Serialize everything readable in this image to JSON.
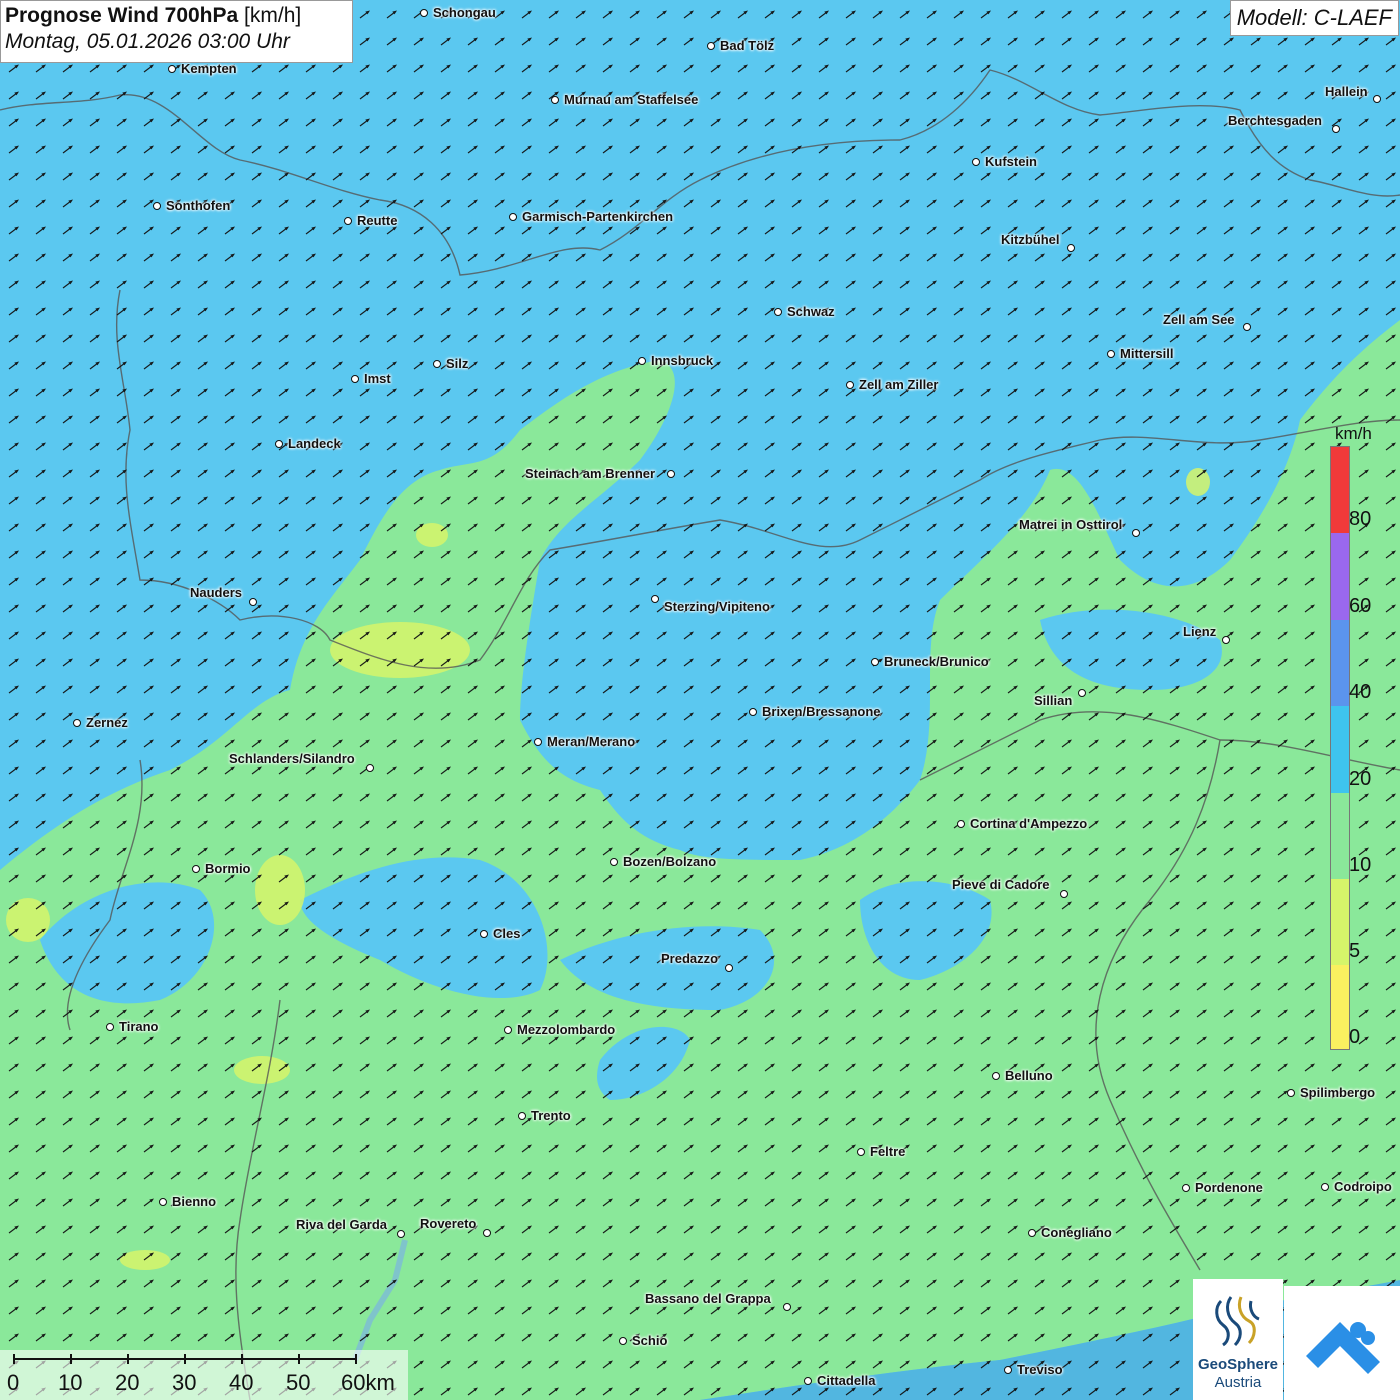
{
  "title": {
    "main": "Prognose Wind 700hPa",
    "unit": "[km/h]",
    "datetime": "Montag, 05.01.2026 03:00 Uhr"
  },
  "model": "Modell: C-LAEF",
  "legend": {
    "unit": "km/h",
    "labels": [
      "80",
      "60",
      "40",
      "20",
      "10",
      "5",
      "0"
    ],
    "colors": [
      "#f03a3a",
      "#9a68ef",
      "#5b94ed",
      "#3ec4ef",
      "#8ae89a",
      "#d6f56a",
      "#faf060"
    ]
  },
  "cities": [
    "Schongau",
    "Bad Tölz",
    "Kempten",
    "Murnau am Staffelsee",
    "Hallein",
    "Berchtesgaden",
    "Kufstein",
    "Sonthofen",
    "Reutte",
    "Garmisch-Partenkirchen",
    "Kitzbühel",
    "Schwaz",
    "Zell am See",
    "Mittersill",
    "Innsbruck",
    "Silz",
    "Imst",
    "Zell am Ziller",
    "Landeck",
    "Steinach am Brenner",
    "Matrei in Osttirol",
    "Nauders",
    "Sterzing/Vipiteno",
    "Lienz",
    "Bruneck/Brunico",
    "Sillian",
    "Zernez",
    "Brixen/Bressanone",
    "Meran/Merano",
    "Schlanders/Silandro",
    "Cortina d'Ampezzo",
    "Bormio",
    "Bozen/Bolzano",
    "Pieve di Cadore",
    "Cles",
    "Predazzo",
    "Tirano",
    "Mezzolombardo",
    "Belluno",
    "Spilimbergo",
    "Trento",
    "Feltre",
    "Bienno",
    "Pordenone",
    "Codroipo",
    "Riva del Garda",
    "Rovereto",
    "Conegliano",
    "Bassano del Grappa",
    "Schio",
    "Treviso",
    "Cittadella"
  ],
  "scale": {
    "labels": [
      "0",
      "10",
      "20",
      "30",
      "40",
      "50",
      "60km"
    ]
  },
  "logo": {
    "line1": "GeoSphere",
    "line2": "Austria"
  },
  "colors": {
    "sea": "#52b6e0",
    "speed_10_20": "#8ae89a",
    "speed_5_10": "#d6f56a",
    "speed_20_40": "#5bc8f0"
  }
}
